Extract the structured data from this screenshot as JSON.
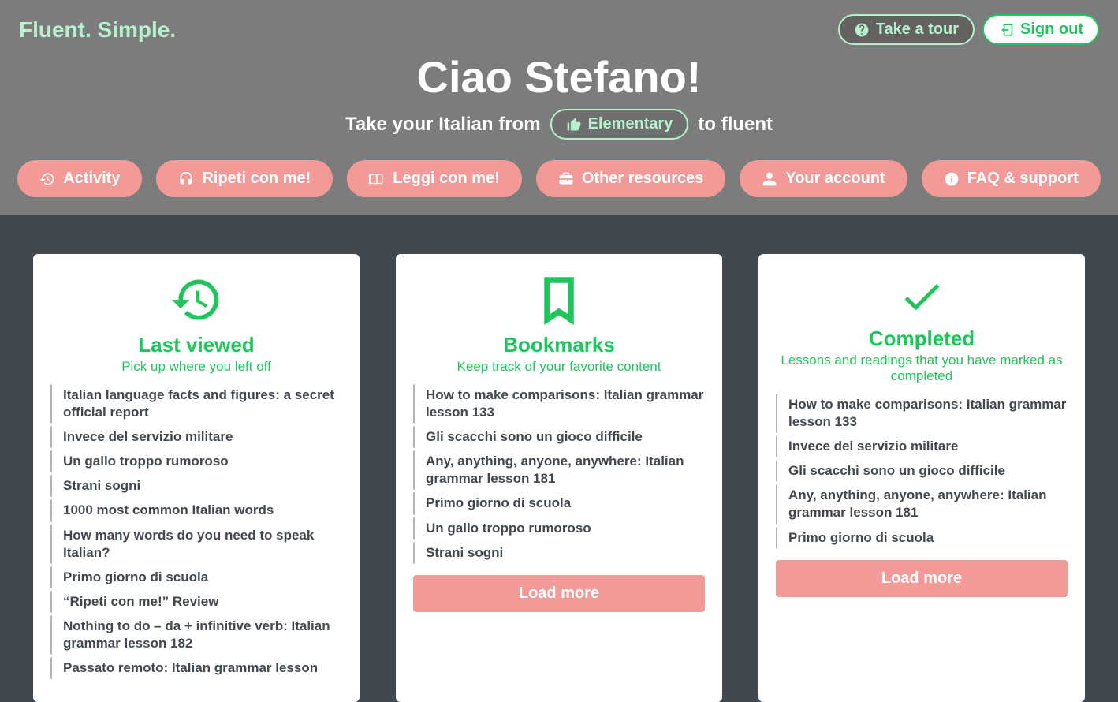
{
  "brand": "Fluent. Simple.",
  "top_buttons": {
    "tour": "Take a tour",
    "signout": "Sign out"
  },
  "greeting": {
    "title": "Ciao Stefano!",
    "pre": "Take your Italian from",
    "level": "Elementary",
    "post": "to fluent"
  },
  "nav": {
    "activity": "Activity",
    "ripeti": "Ripeti con me!",
    "leggi": "Leggi con me!",
    "other": "Other resources",
    "account": "Your account",
    "faq": "FAQ & support"
  },
  "cards": {
    "last_viewed": {
      "title": "Last viewed",
      "sub": "Pick up where you left off",
      "items": [
        "Italian language facts and figures: a secret official report",
        "Invece del servizio militare",
        "Un gallo troppo rumoroso",
        "Strani sogni",
        "1000 most common Italian words",
        "How many words do you need to speak Italian?",
        "Primo giorno di scuola",
        "“Ripeti con me!” Review",
        "Nothing to do – da + infinitive verb: Italian grammar lesson 182",
        "Passato remoto: Italian grammar lesson"
      ]
    },
    "bookmarks": {
      "title": "Bookmarks",
      "sub": "Keep track of your favorite content",
      "items": [
        "How to make comparisons: Italian grammar lesson 133",
        "Gli scacchi sono un gioco difficile",
        "Any, anything, anyone, anywhere: Italian grammar lesson 181",
        "Primo giorno di scuola",
        "Un gallo troppo rumoroso",
        "Strani sogni"
      ],
      "load_more": "Load more"
    },
    "completed": {
      "title": "Completed",
      "sub": "Lessons and readings that you have marked as completed",
      "items": [
        "How to make comparisons: Italian grammar lesson 133",
        "Invece del servizio militare",
        "Gli scacchi sono un gioco difficile",
        "Any, anything, anyone, anywhere: Italian grammar lesson 181",
        "Primo giorno di scuola"
      ],
      "load_more": "Load more"
    }
  }
}
